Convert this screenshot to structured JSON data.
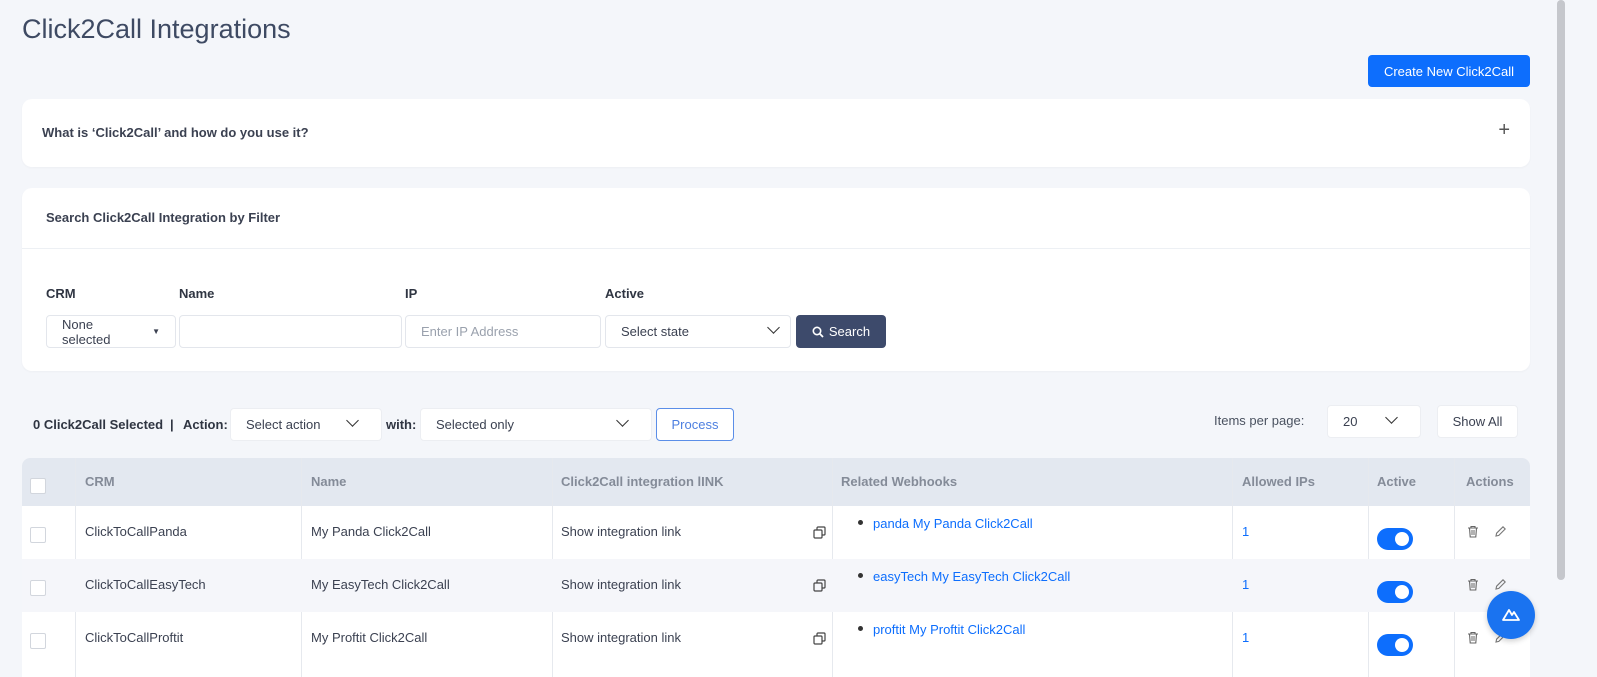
{
  "page": {
    "title": "Click2Call Integrations",
    "create_button": "Create New Click2Call"
  },
  "faq": {
    "title": "What is ‘Click2Call’ and how do you use it?",
    "toggle": "+"
  },
  "filter": {
    "title": "Search Click2Call Integration by Filter",
    "crm_label": "CRM",
    "crm_value": "None selected",
    "name_label": "Name",
    "name_value": "",
    "ip_label": "IP",
    "ip_placeholder": "Enter IP Address",
    "active_label": "Active",
    "active_value": "Select state",
    "search_button": "Search"
  },
  "toolbar": {
    "selected_text": "0 Click2Call Selected",
    "separator": "|",
    "action_label": "Action:",
    "action_value": "Select action",
    "with_label": "with:",
    "with_value": "Selected only",
    "process_button": "Process",
    "items_per_page_label": "Items per page:",
    "items_per_page_value": "20",
    "show_all_button": "Show All"
  },
  "table": {
    "headers": {
      "crm": "CRM",
      "name": "Name",
      "link": "Click2Call integration lINK",
      "webhooks": "Related Webhooks",
      "ips": "Allowed IPs",
      "active": "Active",
      "actions": "Actions"
    },
    "rows": [
      {
        "crm": "ClickToCallPanda",
        "name": "My Panda Click2Call",
        "link": "Show integration link",
        "webhook": "panda My Panda Click2Call",
        "ips": "1",
        "active": true
      },
      {
        "crm": "ClickToCallEasyTech",
        "name": "My EasyTech Click2Call",
        "link": "Show integration link",
        "webhook": "easyTech My EasyTech Click2Call",
        "ips": "1",
        "active": true
      },
      {
        "crm": "ClickToCallProftit",
        "name": "My Proftit Click2Call",
        "link": "Show integration link",
        "webhook": "proftit My Proftit Click2Call",
        "ips": "1",
        "active": true
      }
    ]
  },
  "colors": {
    "primary": "#0d6efd",
    "search_button": "#3d4a6b",
    "header_bg": "#e3e8f0",
    "page_bg": "#f4f6fa"
  }
}
